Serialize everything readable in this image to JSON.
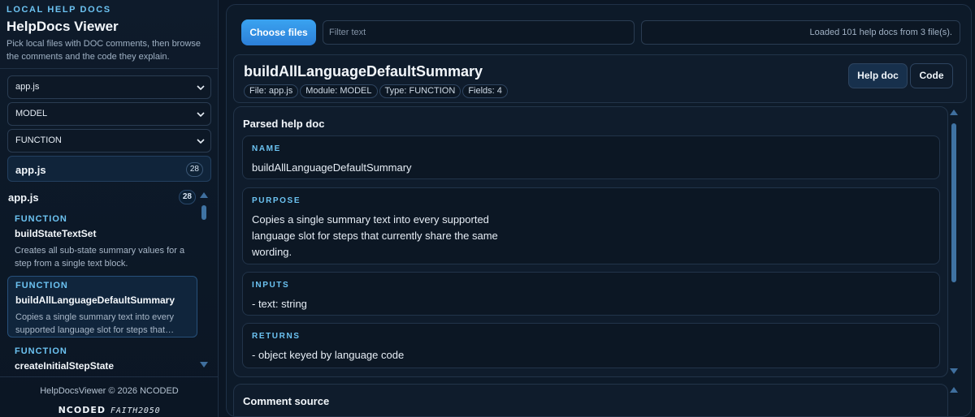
{
  "sidebar": {
    "kicker": "LOCAL HELP DOCS",
    "title": "HelpDocs Viewer",
    "description": "Pick local files with DOC comments, then browse the comments and the code they explain.",
    "filters": {
      "file": "app.js",
      "module": "MODEL",
      "type": "FUNCTION"
    },
    "file_card": {
      "label": "app.js",
      "count": "28"
    },
    "group": {
      "label": "app.js",
      "count": "28"
    },
    "items": [
      {
        "kind": "FUNCTION",
        "name": "buildStateTextSet",
        "desc": "Creates all sub-state summary values for a step from a single text block."
      },
      {
        "kind": "FUNCTION",
        "name": "buildAllLanguageDefaultSummary",
        "desc": "Copies a single summary text into every supported language slot for steps that…"
      },
      {
        "kind": "FUNCTION",
        "name": "createInitialStepState",
        "desc": ""
      }
    ],
    "footer_copy": "HelpDocsViewer © 2026 NCODED",
    "footer_logo_1": "NCODED",
    "footer_logo_2": "FAITH2050"
  },
  "toolbar": {
    "choose_label": "Choose files",
    "filter_placeholder": "Filter text",
    "filter_value": "",
    "status": "Loaded 101 help docs from 3 file(s)."
  },
  "doc": {
    "title": "buildAllLanguageDefaultSummary",
    "chips": [
      "File: app.js",
      "Module: MODEL",
      "Type: FUNCTION",
      "Fields: 4"
    ],
    "tab_helpdoc": "Help doc",
    "tab_code": "Code"
  },
  "parsed": {
    "title": "Parsed help doc",
    "fields": [
      {
        "label": "NAME",
        "value": "buildAllLanguageDefaultSummary"
      },
      {
        "label": "PURPOSE",
        "value": "Copies a single summary text into every supported language slot for steps that currently share the same wording."
      },
      {
        "label": "INPUTS",
        "value": "- text: string"
      },
      {
        "label": "RETURNS",
        "value": "- object keyed by language code"
      }
    ]
  },
  "comment_source": {
    "title": "Comment source"
  },
  "colors": {
    "accent": "#6cc3f2",
    "primary_button": "#2c7fd8",
    "background": "#0b1624"
  }
}
